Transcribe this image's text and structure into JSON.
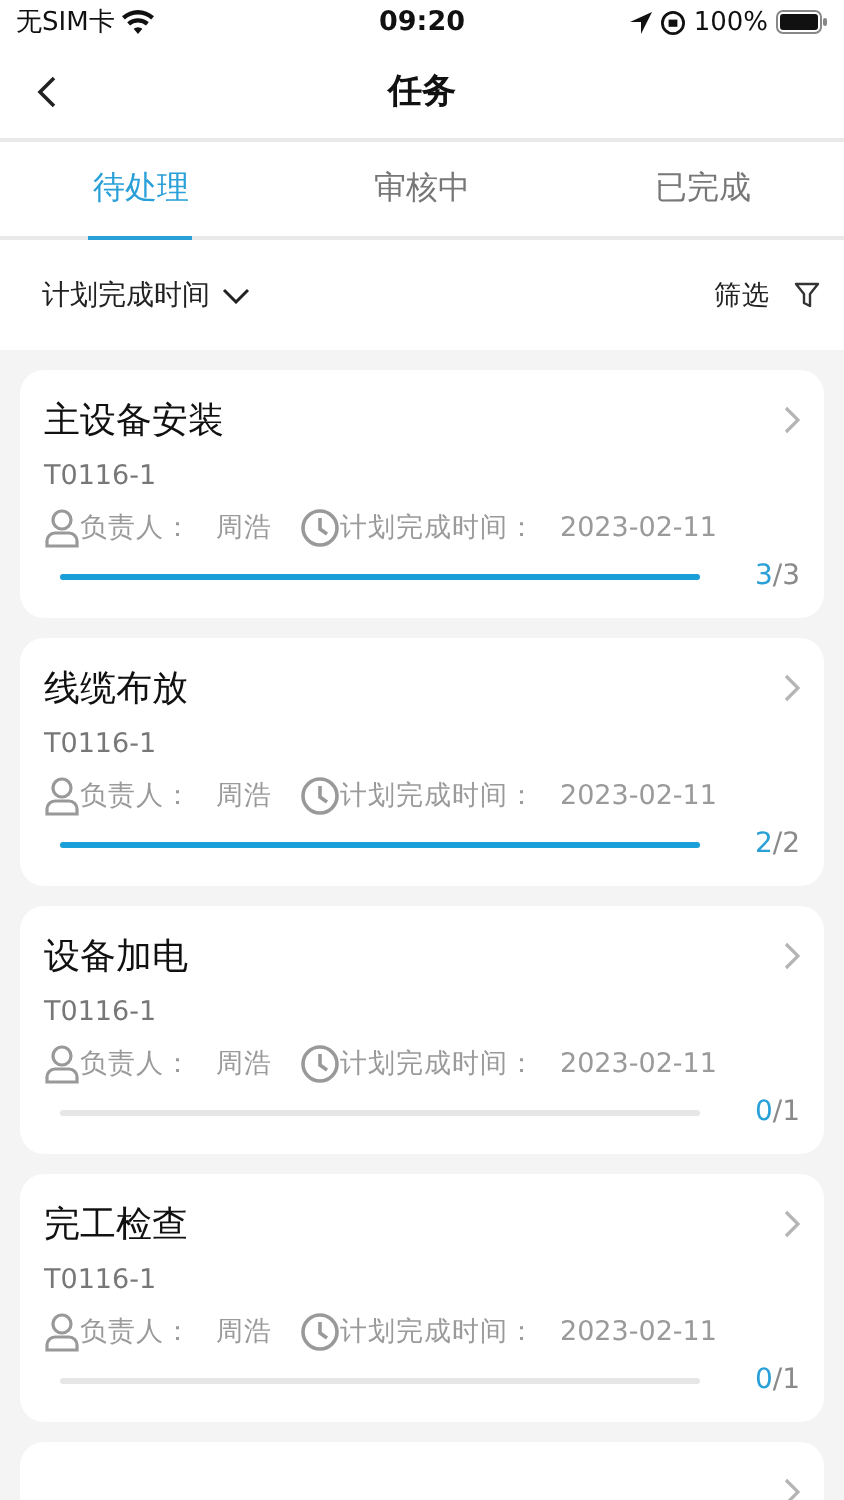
{
  "status_bar": {
    "carrier": "无SIM卡",
    "time": "09:20",
    "battery": "100%"
  },
  "nav": {
    "title": "任务"
  },
  "tabs": [
    {
      "label": "待处理",
      "selected": true
    },
    {
      "label": "审核中",
      "selected": false
    },
    {
      "label": "已完成",
      "selected": false
    }
  ],
  "sort": {
    "label": "计划完成时间"
  },
  "filter": {
    "label": "筛选"
  },
  "tasks": [
    {
      "title": "主设备安装",
      "code": "T0116-1",
      "owner_label": "负责人：",
      "owner": "周浩",
      "due_label": "计划完成时间：",
      "due": "2023-02-11",
      "level": 1,
      "done": "3",
      "total": "/3"
    },
    {
      "title": "线缆布放",
      "code": "T0116-1",
      "owner_label": "负责人：",
      "owner": "周浩",
      "due_label": "计划完成时间：",
      "due": "2023-02-11",
      "level": 1,
      "done": "2",
      "total": "/2"
    },
    {
      "title": "设备加电",
      "code": "T0116-1",
      "owner_label": "负责人：",
      "owner": "周浩",
      "due_label": "计划完成时间：",
      "due": "2023-02-11",
      "level": 0,
      "done": "0",
      "total": "/1"
    },
    {
      "title": "完工检查",
      "code": "T0116-1",
      "owner_label": "负责人：",
      "owner": "周浩",
      "due_label": "计划完成时间：",
      "due": "2023-02-11",
      "level": 0,
      "done": "0",
      "total": "/1"
    }
  ],
  "list_continues": true
}
